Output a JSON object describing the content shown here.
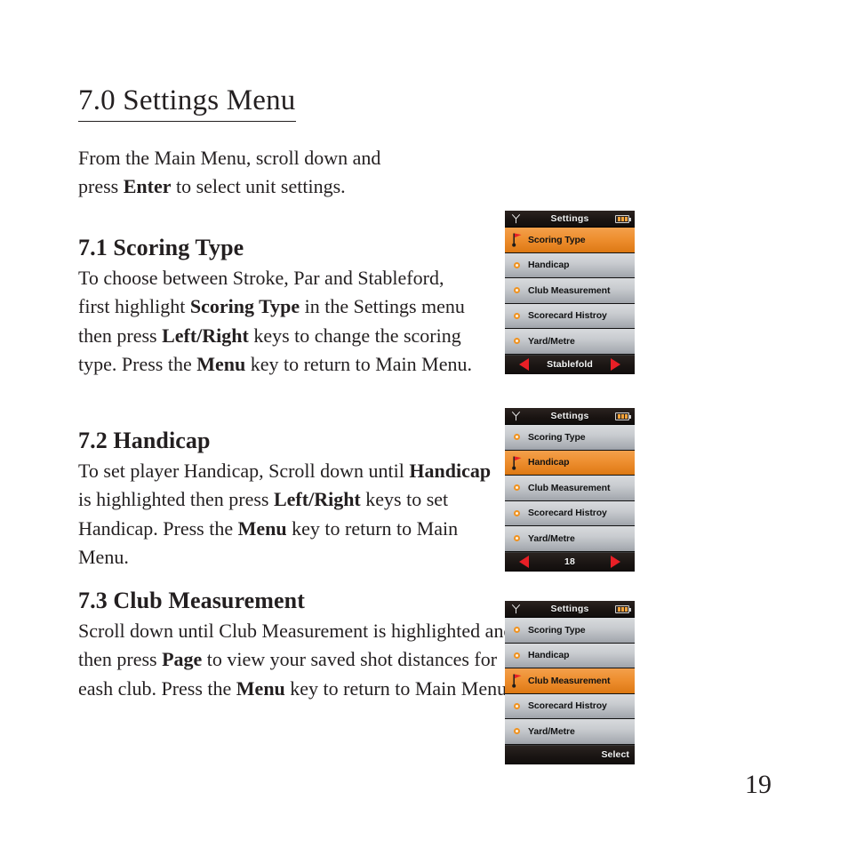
{
  "document": {
    "heading": "7.0 Settings Menu",
    "page_number": "19",
    "intro": "From the Main Menu, scroll down and press Enter to select unit settings.",
    "intro_parts": {
      "a": "From the Main Menu, scroll down and press ",
      "b": "Enter",
      "c": " to select unit settings."
    },
    "sections": [
      {
        "heading": "7.1 Scoring Type",
        "body_parts": {
          "a": "To choose between Stroke, Par and Stableford, first highlight ",
          "b": "Scoring Type",
          "c": " in the Settings menu then press ",
          "d": "Left/Right",
          "e": " keys to change the scoring type. Press the ",
          "f": "Menu",
          "g": " key to return to Main Menu."
        }
      },
      {
        "heading": "7.2 Handicap",
        "body_parts": {
          "a": "To set player Handicap, Scroll down until ",
          "b": "Handicap ",
          "c": " is highlighted then press ",
          "d": "Left/Right",
          "e": " keys to set Handicap. Press the ",
          "f": "Menu",
          "g": " key to return to Main Menu."
        }
      },
      {
        "heading": "7.3 Club Measurement",
        "body_parts": {
          "a": "Scroll down until Club Measurement is highlighted and then press ",
          "b": "Page",
          "c": " to view your saved shot distances for eash club. Press the ",
          "d": "Menu",
          "e": " key to return to Main Menu."
        }
      }
    ]
  },
  "colors": {
    "highlight_orange": "#ee8f30",
    "row_gray": "#c9ccd0",
    "bar_black": "#1a1513",
    "arrow_red": "#e81f26",
    "bullet_orange": "#f0921f"
  },
  "devices": [
    {
      "header_title": "Settings",
      "rows": [
        {
          "label": "Scoring Type",
          "selected": true
        },
        {
          "label": "Handicap",
          "selected": false
        },
        {
          "label": "Club Measurement",
          "selected": false
        },
        {
          "label": "Scorecard Histroy",
          "selected": false
        },
        {
          "label": "Yard/Metre",
          "selected": false
        }
      ],
      "footer": {
        "text": "Stablefold",
        "arrows": true,
        "align": "center"
      }
    },
    {
      "header_title": "Settings",
      "rows": [
        {
          "label": "Scoring Type",
          "selected": false
        },
        {
          "label": "Handicap",
          "selected": true
        },
        {
          "label": "Club Measurement",
          "selected": false
        },
        {
          "label": "Scorecard Histroy",
          "selected": false
        },
        {
          "label": "Yard/Metre",
          "selected": false
        }
      ],
      "footer": {
        "text": "18",
        "arrows": true,
        "align": "center"
      }
    },
    {
      "header_title": "Settings",
      "rows": [
        {
          "label": "Scoring Type",
          "selected": false
        },
        {
          "label": "Handicap",
          "selected": false
        },
        {
          "label": "Club Measurement",
          "selected": true
        },
        {
          "label": "Scorecard Histroy",
          "selected": false
        },
        {
          "label": "Yard/Metre",
          "selected": false
        }
      ],
      "footer": {
        "text": "Select",
        "arrows": false,
        "align": "right"
      }
    }
  ]
}
